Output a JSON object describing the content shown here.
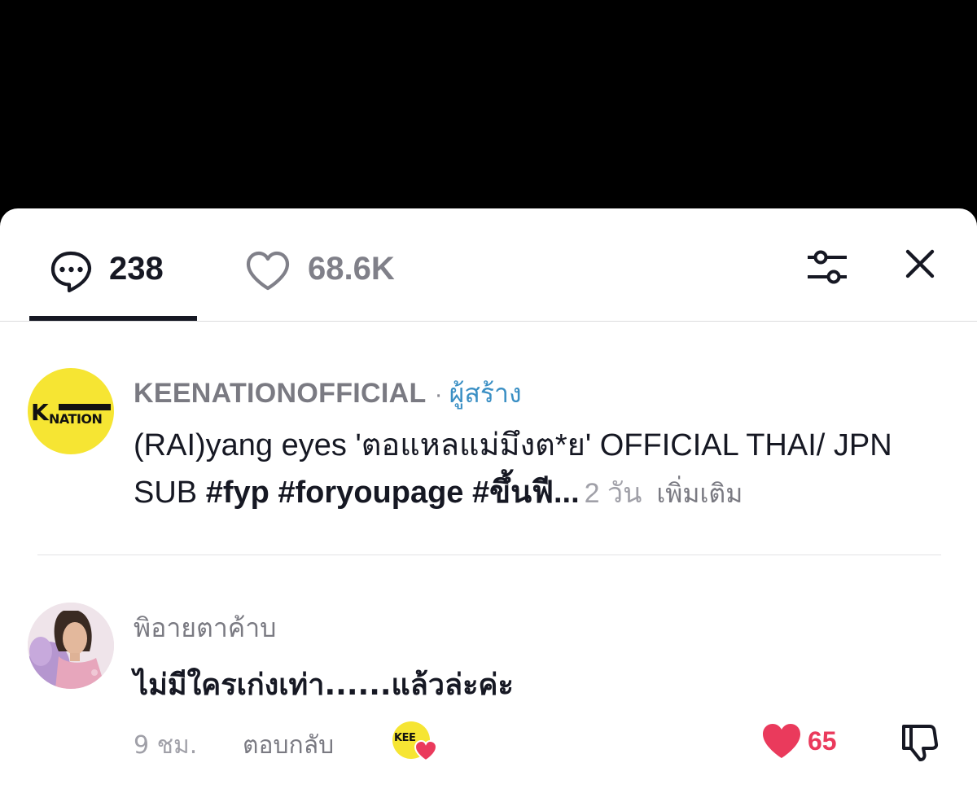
{
  "header": {
    "comment_count": "238",
    "like_count": "68.6K",
    "active_tab": "comments"
  },
  "icons": {
    "comments": "speech-bubble-icon",
    "likes": "heart-outline-icon",
    "filter": "sliders-icon",
    "close": "close-icon",
    "like": "heart-filled-icon",
    "dislike": "thumbs-down-icon"
  },
  "colors": {
    "accent_blue": "#3a8fc4",
    "like_red": "#ea3a5c",
    "text_primary": "#161823",
    "text_secondary": "#7a7a82",
    "creator_yellow": "#f6e533"
  },
  "creator_post": {
    "username": "KEENATIONOFFICIAL",
    "separator": "·",
    "role_tag": "ผู้สร้าง",
    "caption_text": "(RAI)yang eyes 'ตอแหลแม่มึงต*ย' OFFICIAL THAI/ JPN SUB ",
    "hashtags": "#fyp #foryoupage #ขึ้นฟี...",
    "time": "2 วัน",
    "more_label": "เพิ่มเติม"
  },
  "comment": {
    "username": "พิอายตาค้าบ",
    "text": "ไม่มีใครเก่งเท่า......แล้วล่ะค่ะ",
    "time": "9 ชม.",
    "reply_label": "ตอบกลับ",
    "like_count": "65"
  }
}
